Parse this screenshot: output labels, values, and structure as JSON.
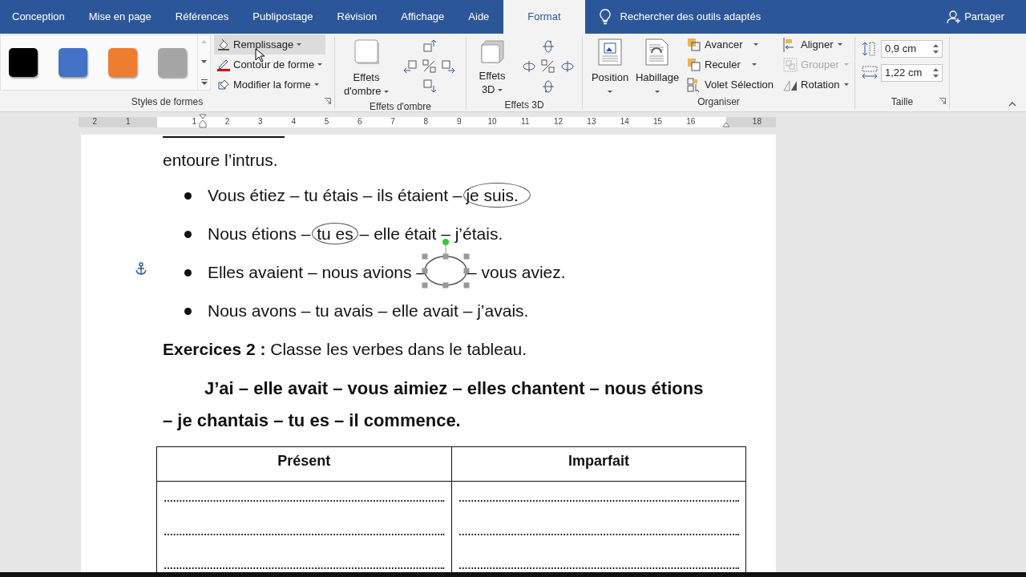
{
  "tabs": [
    {
      "label": "Conception",
      "selected": false
    },
    {
      "label": "Mise en page",
      "selected": false
    },
    {
      "label": "Références",
      "selected": false
    },
    {
      "label": "Publipostage",
      "selected": false
    },
    {
      "label": "Révision",
      "selected": false
    },
    {
      "label": "Affichage",
      "selected": false
    },
    {
      "label": "Aide",
      "selected": false
    },
    {
      "label": "Format",
      "selected": true
    }
  ],
  "tell_me": "Rechercher des outils adaptés",
  "share": "Partager",
  "shape_styles": {
    "label": "Styles de formes",
    "swatches": [
      {
        "color": "#000000"
      },
      {
        "color": "#4472c4"
      },
      {
        "color": "#ed7d31"
      },
      {
        "color": "#a5a5a5"
      }
    ],
    "buttons": [
      {
        "label": "Remplissage",
        "hovered": true
      },
      {
        "label": "Contour de forme",
        "hovered": false
      },
      {
        "label": "Modifier la forme",
        "hovered": false
      }
    ]
  },
  "shadow_effects": {
    "label": "Effets d'ombre",
    "button": "Effets d'ombre"
  },
  "effects_3d": {
    "label": "Effets 3D",
    "button": "Effets 3D"
  },
  "arrange": {
    "label": "Organiser",
    "big_buttons": [
      "Position",
      "Habillage"
    ],
    "commands": [
      {
        "label": "Avancer",
        "disabled": false
      },
      {
        "label": "Reculer",
        "disabled": false
      },
      {
        "label": "Volet Sélection",
        "disabled": false
      },
      {
        "label": "Aligner",
        "disabled": false
      },
      {
        "label": "Grouper",
        "disabled": true
      },
      {
        "label": "Rotation",
        "disabled": false
      }
    ]
  },
  "size": {
    "label": "Taille",
    "height": "0,9 cm",
    "width": "1,22 cm"
  },
  "ruler": {
    "labels": [
      "2",
      "1",
      "1",
      "2",
      "3",
      "4",
      "5",
      "6",
      "7",
      "8",
      "9",
      "10",
      "11",
      "12",
      "13",
      "14",
      "15",
      "16",
      "18"
    ]
  },
  "document": {
    "intro": "entoure l’intrus.",
    "bullets": [
      {
        "parts": [
          {
            "kind": "text",
            "text": "Vous étiez – tu étais – ils étaient – "
          },
          {
            "kind": "circled",
            "text": "je suis."
          }
        ]
      },
      {
        "parts": [
          {
            "kind": "text",
            "text": "Nous étions – "
          },
          {
            "kind": "circled",
            "text": "tu es"
          },
          {
            "kind": "text",
            "text": " – elle était – j’étais."
          }
        ]
      },
      {
        "parts": [
          {
            "kind": "text",
            "text": "Elles avaient – nous avions –"
          },
          {
            "kind": "shape",
            "selected": true
          },
          {
            "kind": "text",
            "text": "– vous aviez."
          }
        ]
      },
      {
        "parts": [
          {
            "kind": "text",
            "text": "Nous avons – tu avais – elle avait – j’avais."
          }
        ]
      }
    ],
    "exercise": "**Exercices 2 :** Classe les verbes dans le tableau.",
    "sentence": "J’ai – elle avait – vous aimiez – elles chantent – nous étions – je chantais – tu es – il commence.",
    "table": {
      "columns": [
        "Présent",
        "Imparfait"
      ],
      "rows": [
        [
          "………………………………………………………………………………..",
          "……………………………………………………………………………….."
        ],
        [
          "………………………………………………………………………………..",
          "……………………………………………………………………………….."
        ],
        [
          "………………………………………………………………………………..",
          "……………………………………………………………………………….."
        ]
      ]
    }
  }
}
